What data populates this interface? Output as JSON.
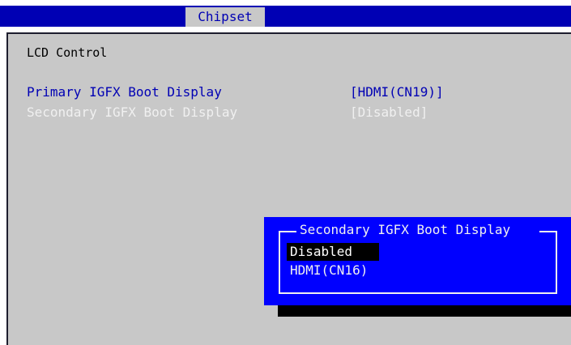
{
  "header": {
    "active_tab": "Chipset"
  },
  "page": {
    "section_title": "LCD Control",
    "items": [
      {
        "label": "Primary IGFX Boot Display",
        "value": "[HDMI(CN19)]"
      },
      {
        "label": "Secondary IGFX Boot Display",
        "value": "[Disabled]"
      }
    ]
  },
  "popup": {
    "title": "Secondary IGFX Boot Display",
    "options": [
      "Disabled",
      "HDMI(CN16)"
    ],
    "selected_index": 0
  },
  "colors": {
    "bar_blue": "#0000b4",
    "panel_gray": "#c8c8c8",
    "popup_blue": "#0000ff",
    "text_white": "#f0f0f0",
    "highlight_black": "#000000"
  }
}
